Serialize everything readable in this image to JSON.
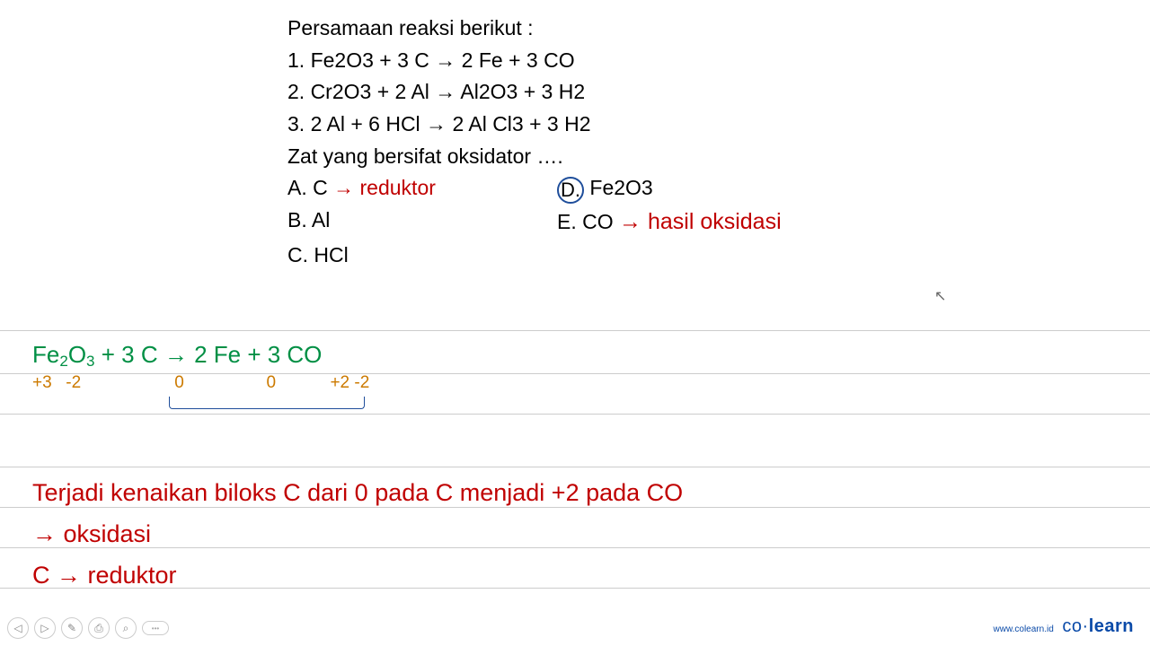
{
  "question": {
    "heading": "Persamaan reaksi berikut  :",
    "eq1": "1.   Fe2O3  + 3 C  →  2 Fe  +  3 CO",
    "eq2": "2.   Cr2O3   +  2 Al  →  Al2O3  + 3 H2",
    "eq3": "3.   2 Al  + 6 HCl  →  2 Al Cl3  + 3 H2",
    "prompt": "Zat yang bersifat oksidator ….",
    "optA_label": "A.   C",
    "optA_note": "→ reduktor",
    "optB_label": "B.   Al",
    "optC_label": "C.   HCl",
    "optD_letter": "D.",
    "optD_text": "  Fe2O3",
    "optE_label": "E.   CO",
    "optE_note": "→ hasil oksidasi"
  },
  "working": {
    "equation_html": "Fe₂O₃ + 3 C → 2 Fe + 3 CO",
    "ox_fe": "+3",
    "ox_o1": "-2",
    "ox_c": "0",
    "ox_fe2": "0",
    "ox_c2": "+2",
    "ox_o2": "-2"
  },
  "answer": {
    "line1": "Terjadi kenaikan biloks C dari 0 pada C menjadi +2 pada CO",
    "line2": "→ oksidasi",
    "line3": "C → reduktor"
  },
  "brand": {
    "site": "www.colearn.id",
    "logo_a": "co",
    "logo_dot": "·",
    "logo_b": "learn"
  }
}
